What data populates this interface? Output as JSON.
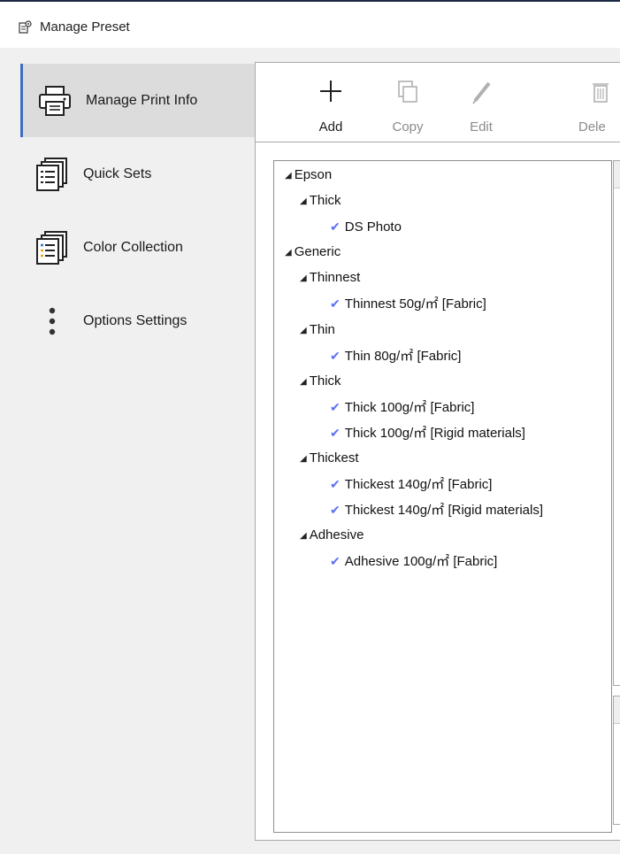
{
  "window": {
    "title": "Manage Preset"
  },
  "sidebar": {
    "items": [
      {
        "label": "Manage Print Info",
        "icon": "printer-icon",
        "active": true
      },
      {
        "label": "Quick Sets",
        "icon": "quick-sets-icon",
        "active": false
      },
      {
        "label": "Color Collection",
        "icon": "color-collection-icon",
        "active": false
      },
      {
        "label": "Options Settings",
        "icon": "more-vertical-icon",
        "active": false
      }
    ]
  },
  "toolbar": {
    "add": "Add",
    "copy": "Copy",
    "edit": "Edit",
    "delete": "Dele"
  },
  "tree": {
    "epson": "Epson",
    "epson_thick": "Thick",
    "ds_photo": "DS Photo",
    "generic": "Generic",
    "thinnest": "Thinnest",
    "thinnest_50": "Thinnest 50g/㎡ [Fabric]",
    "thin": "Thin",
    "thin_80": "Thin 80g/㎡ [Fabric]",
    "thick": "Thick",
    "thick_100_fabric": "Thick 100g/㎡ [Fabric]",
    "thick_100_rigid": "Thick 100g/㎡ [Rigid materials]",
    "thickest": "Thickest",
    "thickest_140_fabric": "Thickest 140g/㎡ [Fabric]",
    "thickest_140_rigid": "Thickest 140g/㎡ [Rigid materials]",
    "adhesive": "Adhesive",
    "adhesive_100": "Adhesive 100g/㎡ [Fabric]"
  },
  "colors": {
    "accent": "#3c6fc2",
    "check": "#5b6ff5"
  }
}
